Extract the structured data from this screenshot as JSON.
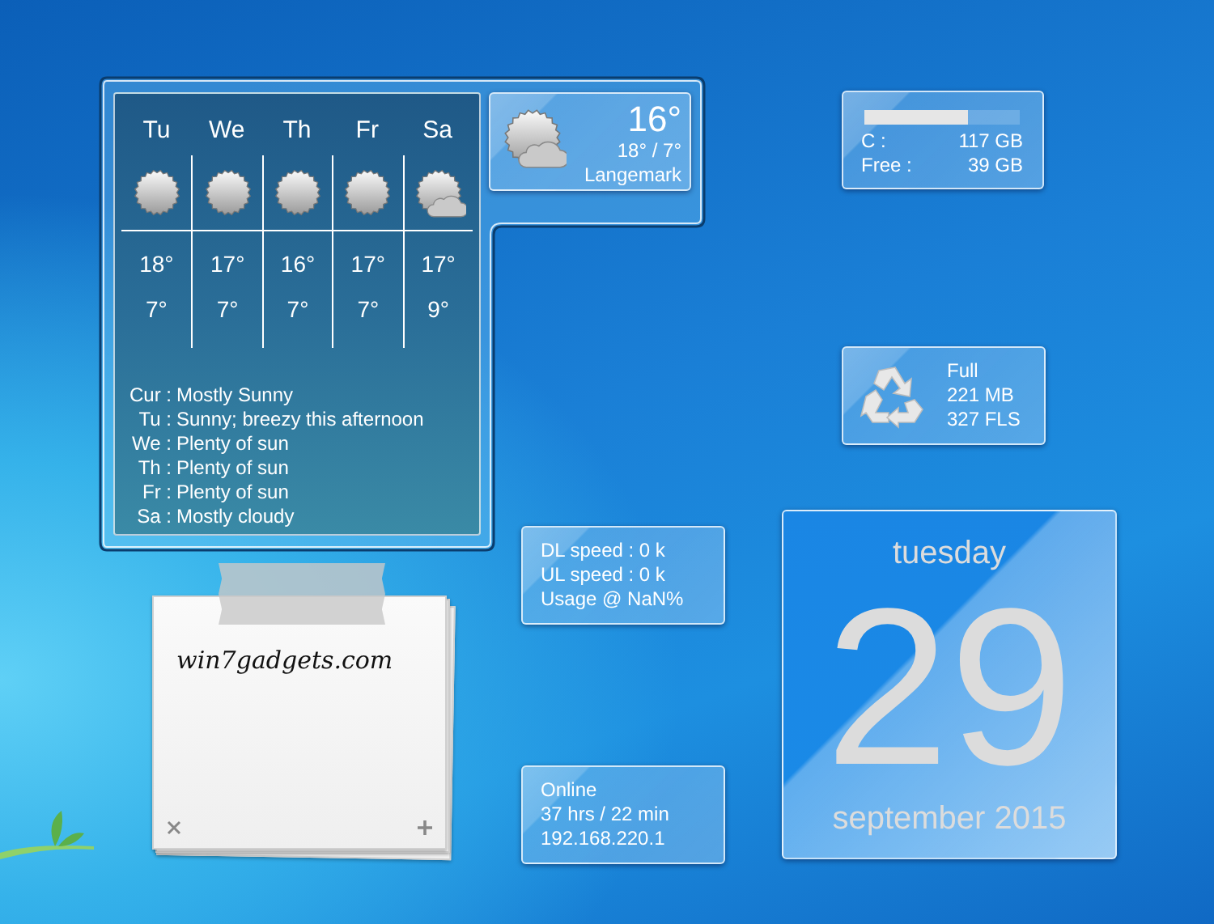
{
  "weather": {
    "current": {
      "kind": "partly-cloudy",
      "temp": "16°",
      "range": "18° / 7°",
      "location": "Langemark"
    },
    "forecast": [
      {
        "day": "Tu",
        "kind": "sunny",
        "high": "18°",
        "low": "7°"
      },
      {
        "day": "We",
        "kind": "sunny",
        "high": "17°",
        "low": "7°"
      },
      {
        "day": "Th",
        "kind": "sunny",
        "high": "16°",
        "low": "7°"
      },
      {
        "day": "Fr",
        "kind": "sunny",
        "high": "17°",
        "low": "7°"
      },
      {
        "day": "Sa",
        "kind": "partly-cloudy",
        "high": "17°",
        "low": "9°"
      }
    ],
    "summary": [
      {
        "label": "Cur :",
        "text": "Mostly Sunny"
      },
      {
        "label": "Tu :",
        "text": "Sunny; breezy this afternoon"
      },
      {
        "label": "We :",
        "text": "Plenty of sun"
      },
      {
        "label": "Th :",
        "text": "Plenty of sun"
      },
      {
        "label": "Fr :",
        "text": "Plenty of sun"
      },
      {
        "label": "Sa :",
        "text": "Mostly cloudy"
      }
    ]
  },
  "drive": {
    "level": 0.67,
    "rows": [
      {
        "label": "C :",
        "value": "117 GB"
      },
      {
        "label": "Free :",
        "value": "39 GB"
      }
    ]
  },
  "recycle_bin": {
    "lines": [
      "Full",
      "221 MB",
      "327 FLS"
    ]
  },
  "network_meter": {
    "lines": [
      "DL speed : 0 k",
      "UL speed : 0 k",
      "Usage @ NaN%"
    ]
  },
  "connection": {
    "lines": [
      "Online",
      "37 hrs / 22 min",
      "192.168.220.1"
    ]
  },
  "calendar": {
    "weekday": "tuesday",
    "day": "29",
    "month_year": "september 2015"
  },
  "note": {
    "text": "win7gadgets.com"
  }
}
